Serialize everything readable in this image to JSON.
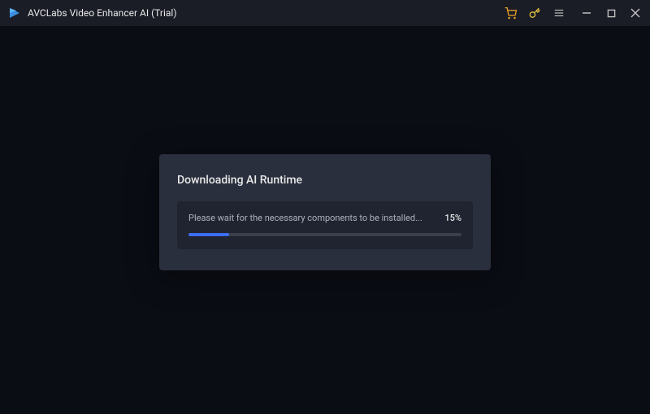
{
  "titlebar": {
    "app_title": "AVCLabs Video Enhancer AI (Trial)"
  },
  "dialog": {
    "title": "Downloading AI Runtime",
    "message": "Please wait for the necessary components to be installed...",
    "percent_text": "15%",
    "percent_value": 15
  }
}
